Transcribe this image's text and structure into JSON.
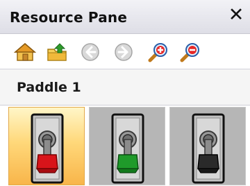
{
  "window": {
    "title": "Resource Pane",
    "close_glyph": "✕"
  },
  "toolbar": {
    "buttons": [
      {
        "icon": "home-icon",
        "enabled": true
      },
      {
        "icon": "up-folder-icon",
        "enabled": true
      },
      {
        "icon": "back-icon",
        "enabled": false
      },
      {
        "icon": "forward-icon",
        "enabled": false
      },
      {
        "icon": "zoom-in-icon",
        "enabled": true
      },
      {
        "icon": "zoom-out-icon",
        "enabled": true
      }
    ]
  },
  "section": {
    "label": "Paddle 1"
  },
  "thumbnails": [
    {
      "icon": "toggle-switch-red-icon",
      "color": "#d8141a",
      "selected": true
    },
    {
      "icon": "toggle-switch-green-icon",
      "color": "#1f9a2a",
      "selected": false
    },
    {
      "icon": "toggle-switch-black-icon",
      "color": "#2a2a2a",
      "selected": false
    }
  ],
  "colors": {
    "accent_selected": "#ffd87a",
    "titlebar": "#e6e6ec"
  }
}
